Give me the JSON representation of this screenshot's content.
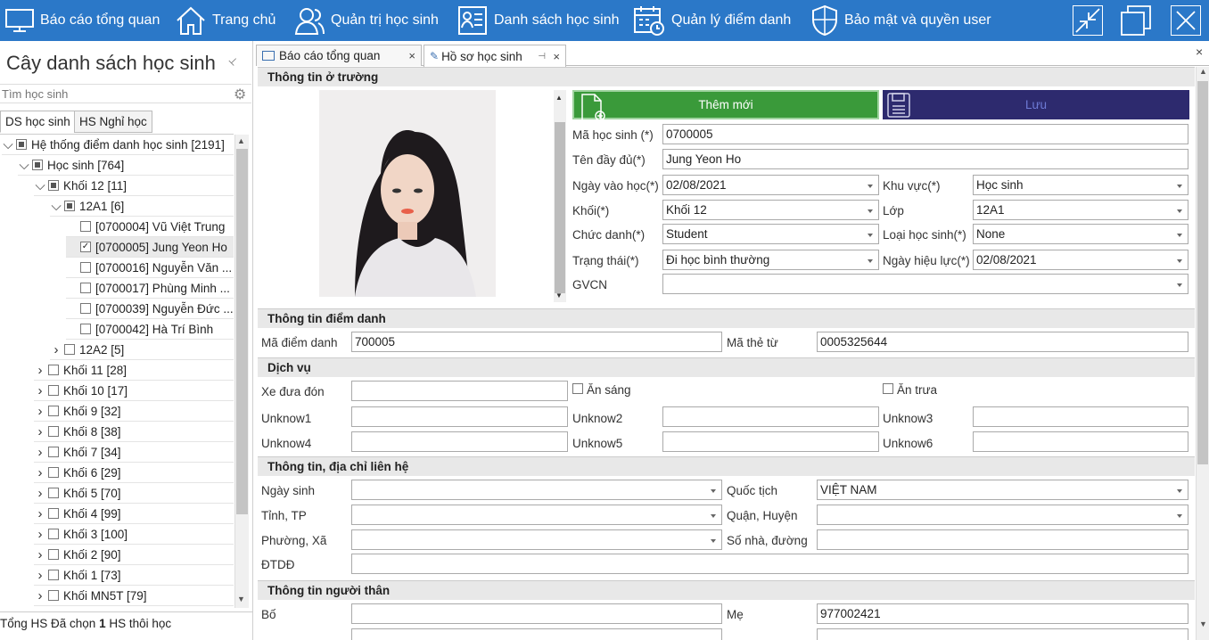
{
  "topbar": {
    "items": [
      {
        "label": "Báo cáo tổng quan",
        "icon": "monitor-icon"
      },
      {
        "label": "Trang chủ",
        "icon": "home-icon"
      },
      {
        "label": "Quản trị học sinh",
        "icon": "users-icon"
      },
      {
        "label": "Danh sách học sinh",
        "icon": "student-list-icon"
      },
      {
        "label": "Quản lý điểm danh",
        "icon": "calendar-clock-icon"
      },
      {
        "label": "Bảo mật và quyền user",
        "icon": "shield-icon"
      }
    ],
    "accent": "#2b78c8"
  },
  "left": {
    "title": "Cây danh sách học sinh",
    "pin": "📌",
    "search_placeholder": "Tìm học sinh",
    "tabs": [
      "DS học sinh",
      "HS Nghỉ học"
    ],
    "tree": [
      {
        "label": "Hệ thống điểm danh học sinh [2191]",
        "exp": "∨",
        "state": "part"
      },
      {
        "label": "Học sinh [764]",
        "exp": "∨",
        "state": "part"
      },
      {
        "label": "Khối 12 [11]",
        "exp": "∨",
        "state": "part"
      },
      {
        "label": "12A1 [6]",
        "exp": "∨",
        "state": "part"
      },
      {
        "label": "[0700004] Vũ Việt Trung",
        "exp": "",
        "state": "off"
      },
      {
        "label": "[0700005] Jung Yeon Ho",
        "exp": "",
        "state": "on"
      },
      {
        "label": "[0700016] Nguyễn Văn ...",
        "exp": "",
        "state": "off"
      },
      {
        "label": "[0700017] Phùng Minh ...",
        "exp": "",
        "state": "off"
      },
      {
        "label": "[0700039] Nguyễn Đức ...",
        "exp": "",
        "state": "off"
      },
      {
        "label": "[0700042] Hà Trí Bình",
        "exp": "",
        "state": "off"
      },
      {
        "label": "12A2 [5]",
        "exp": ">",
        "state": "off"
      },
      {
        "label": "Khối 11 [28]",
        "exp": ">",
        "state": "off"
      },
      {
        "label": "Khối 10 [17]",
        "exp": ">",
        "state": "off"
      },
      {
        "label": "Khối 9 [32]",
        "exp": ">",
        "state": "off"
      },
      {
        "label": "Khối 8 [38]",
        "exp": ">",
        "state": "off"
      },
      {
        "label": "Khối 7 [34]",
        "exp": ">",
        "state": "off"
      },
      {
        "label": "Khối 6 [29]",
        "exp": ">",
        "state": "off"
      },
      {
        "label": "Khối 5 [70]",
        "exp": ">",
        "state": "off"
      },
      {
        "label": "Khối 4 [99]",
        "exp": ">",
        "state": "off"
      },
      {
        "label": "Khối 3 [100]",
        "exp": ">",
        "state": "off"
      },
      {
        "label": "Khối 2 [90]",
        "exp": ">",
        "state": "off"
      },
      {
        "label": "Khối 1 [73]",
        "exp": ">",
        "state": "off"
      },
      {
        "label": "Khối MN5T [79]",
        "exp": ">",
        "state": "off"
      }
    ],
    "status_a": "Tổng HS Đã chọn ",
    "status_b": "1",
    "status_c": " HS thôi học"
  },
  "doc_tabs": [
    {
      "label": "Báo cáo tổng quan",
      "icon": "monitor-icon"
    },
    {
      "label": "Hồ sơ học sinh",
      "icon": "user-doc-icon"
    }
  ],
  "sections": {
    "school": "Thông tin ở trường",
    "attendance": "Thông tin điểm danh",
    "service": "Dịch vụ",
    "contact": "Thông tin, địa chỉ liên hệ",
    "family": "Thông tin người thân"
  },
  "actions": {
    "add": "Thêm mới",
    "save": "Lưu",
    "add_color": "#3a9a3a",
    "save_color": "#2d2a6e"
  },
  "form": {
    "ma_hs": {
      "label": "Mã học sinh (*)",
      "value": "0700005"
    },
    "ten": {
      "label": "Tên đầy đủ(*)",
      "value": "Jung Yeon Ho"
    },
    "ngay_vao": {
      "label": "Ngày vào học(*)",
      "value": "02/08/2021"
    },
    "khu_vuc": {
      "label": "Khu vực(*)",
      "value": "Học sinh"
    },
    "khoi": {
      "label": "Khối(*)",
      "value": "Khối 12"
    },
    "lop": {
      "label": "Lớp",
      "value": "12A1"
    },
    "chuc_danh": {
      "label": "Chức danh(*)",
      "value": "Student"
    },
    "loai_hs": {
      "label": "Loại học sinh(*)",
      "value": "None"
    },
    "trang_thai": {
      "label": "Trạng thái(*)",
      "value": "Đi học bình thường"
    },
    "ngay_hl": {
      "label": "Ngày hiệu lực(*)",
      "value": "02/08/2021"
    },
    "gvcn": {
      "label": "GVCN",
      "value": ""
    },
    "ma_dd": {
      "label": "Mã điểm danh",
      "value": "700005"
    },
    "ma_the": {
      "label": "Mã thẻ từ",
      "value": "0005325644"
    },
    "xe": {
      "label": "Xe đưa đón",
      "value": ""
    },
    "an_sang": "Ăn sáng",
    "an_trua": "Ăn trưa",
    "u1": "Unknow1",
    "u2": "Unknow2",
    "u3": "Unknow3",
    "u4": "Unknow4",
    "u5": "Unknow5",
    "u6": "Unknow6",
    "ngay_sinh": {
      "label": "Ngày sinh",
      "value": ""
    },
    "quoc_tich": {
      "label": "Quốc tịch",
      "value": "VIỆT NAM"
    },
    "tinh": {
      "label": "Tỉnh, TP",
      "value": ""
    },
    "quan": {
      "label": "Quận, Huyện",
      "value": ""
    },
    "phuong": {
      "label": "Phường, Xã",
      "value": ""
    },
    "so_nha": {
      "label": "Số nhà, đường",
      "value": ""
    },
    "dtdd": {
      "label": "ĐTDĐ",
      "value": ""
    },
    "bo": {
      "label": "Bố",
      "value": ""
    },
    "me": {
      "label": "Mẹ",
      "value": "977002421"
    }
  }
}
